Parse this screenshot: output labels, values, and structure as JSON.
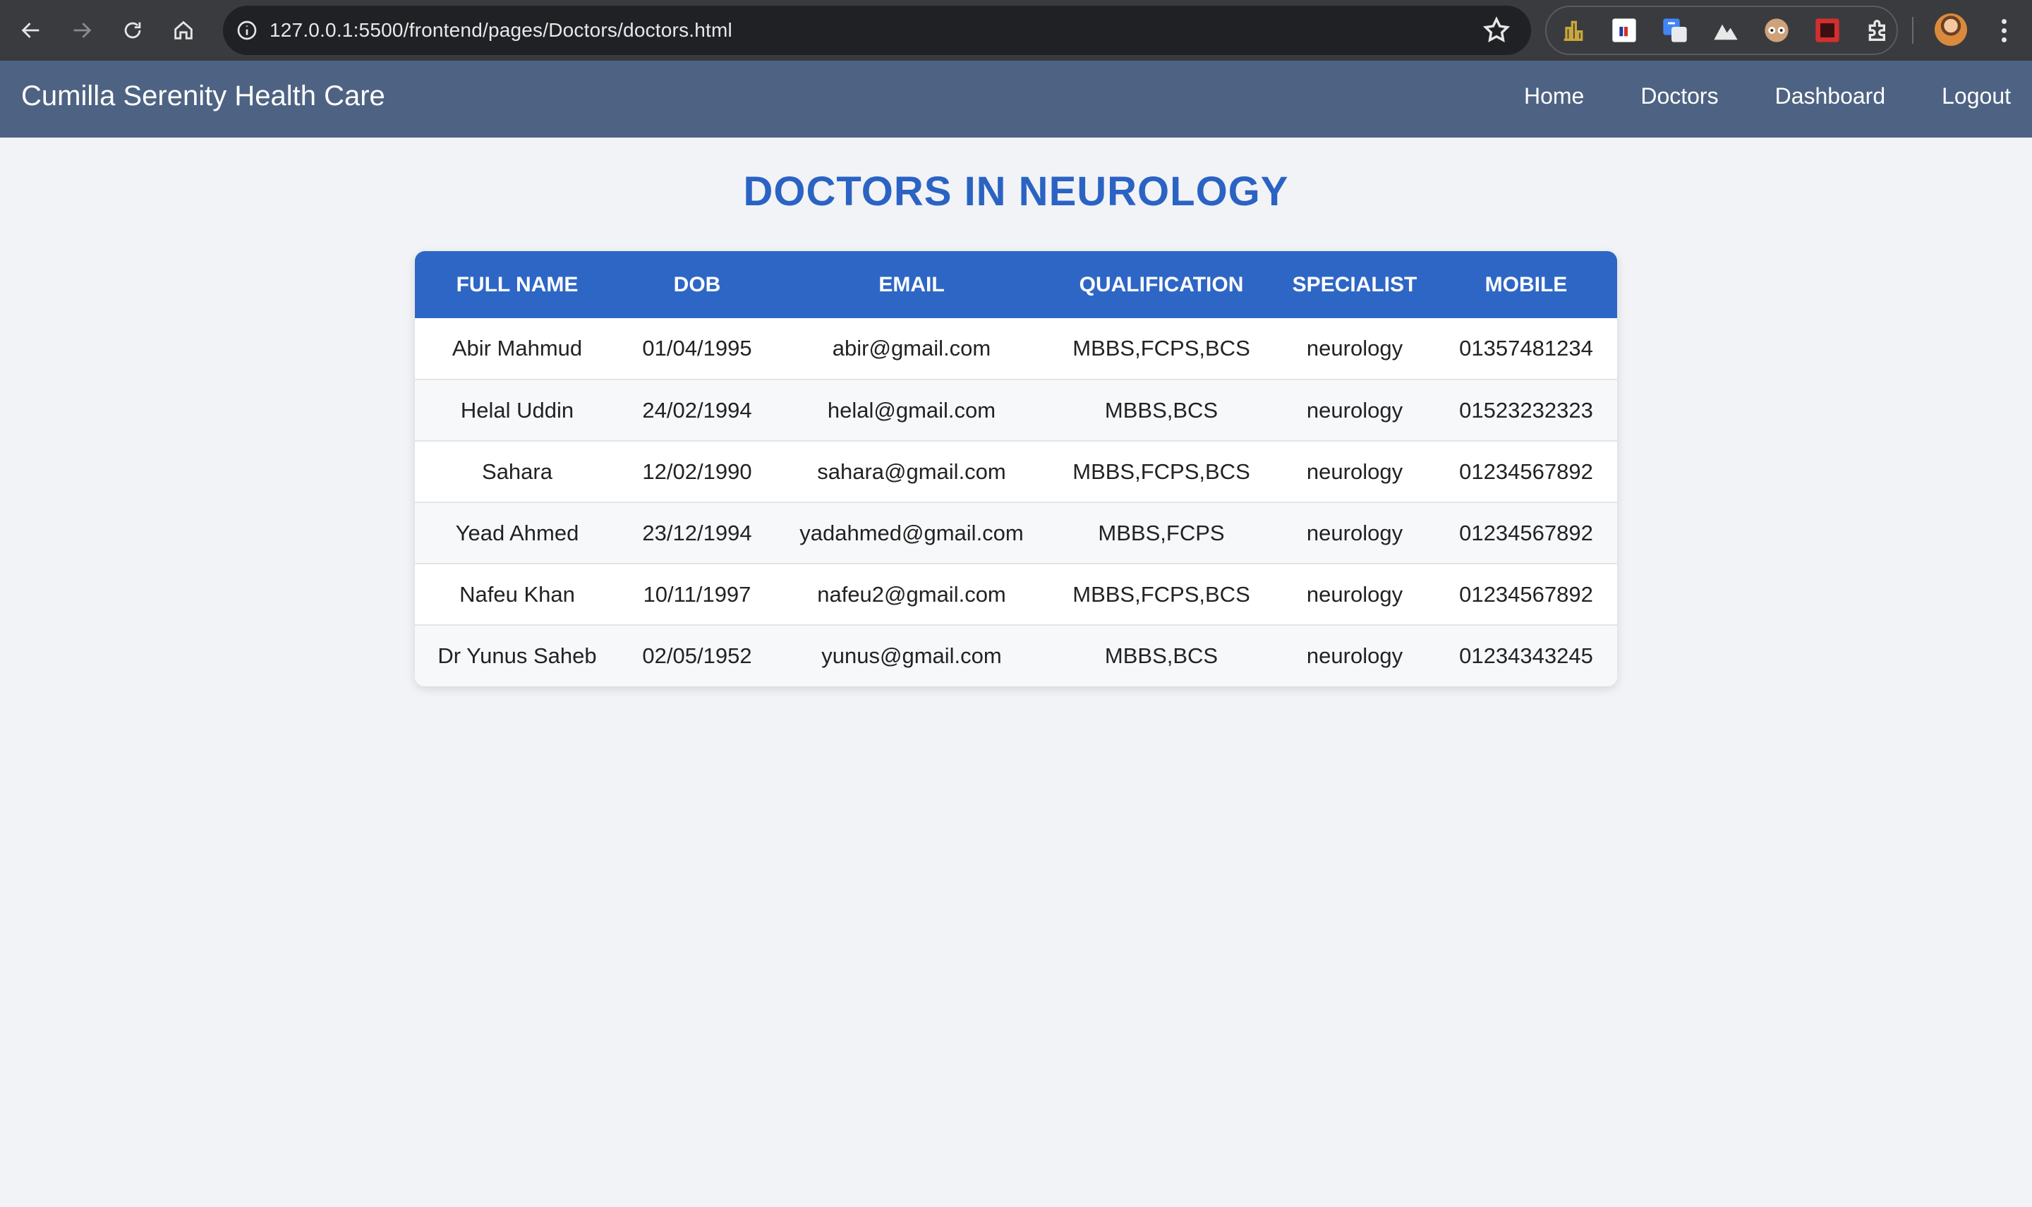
{
  "browser": {
    "url": "127.0.0.1:5500/frontend/pages/Doctors/doctors.html"
  },
  "nav": {
    "brand": "Cumilla Serenity Health Care",
    "links": [
      "Home",
      "Doctors",
      "Dashboard",
      "Logout"
    ]
  },
  "page": {
    "title": "DOCTORS IN NEUROLOGY"
  },
  "table": {
    "headers": [
      "FULL NAME",
      "DOB",
      "EMAIL",
      "QUALIFICATION",
      "SPECIALIST",
      "MOBILE"
    ],
    "rows": [
      [
        "Abir Mahmud",
        "01/04/1995",
        "abir@gmail.com",
        "MBBS,FCPS,BCS",
        "neurology",
        "01357481234"
      ],
      [
        "Helal Uddin",
        "24/02/1994",
        "helal@gmail.com",
        "MBBS,BCS",
        "neurology",
        "01523232323"
      ],
      [
        "Sahara",
        "12/02/1990",
        "sahara@gmail.com",
        "MBBS,FCPS,BCS",
        "neurology",
        "01234567892"
      ],
      [
        "Yead Ahmed",
        "23/12/1994",
        "yadahmed@gmail.com",
        "MBBS,FCPS",
        "neurology",
        "01234567892"
      ],
      [
        "Nafeu Khan",
        "10/11/1997",
        "nafeu2@gmail.com",
        "MBBS,FCPS,BCS",
        "neurology",
        "01234567892"
      ],
      [
        "Dr Yunus Saheb",
        "02/05/1952",
        "yunus@gmail.com",
        "MBBS,BCS",
        "neurology",
        "01234343245"
      ]
    ]
  },
  "colors": {
    "nav_bg": "#4e6383",
    "title": "#2b63c4",
    "table_header": "#2e66c6"
  }
}
